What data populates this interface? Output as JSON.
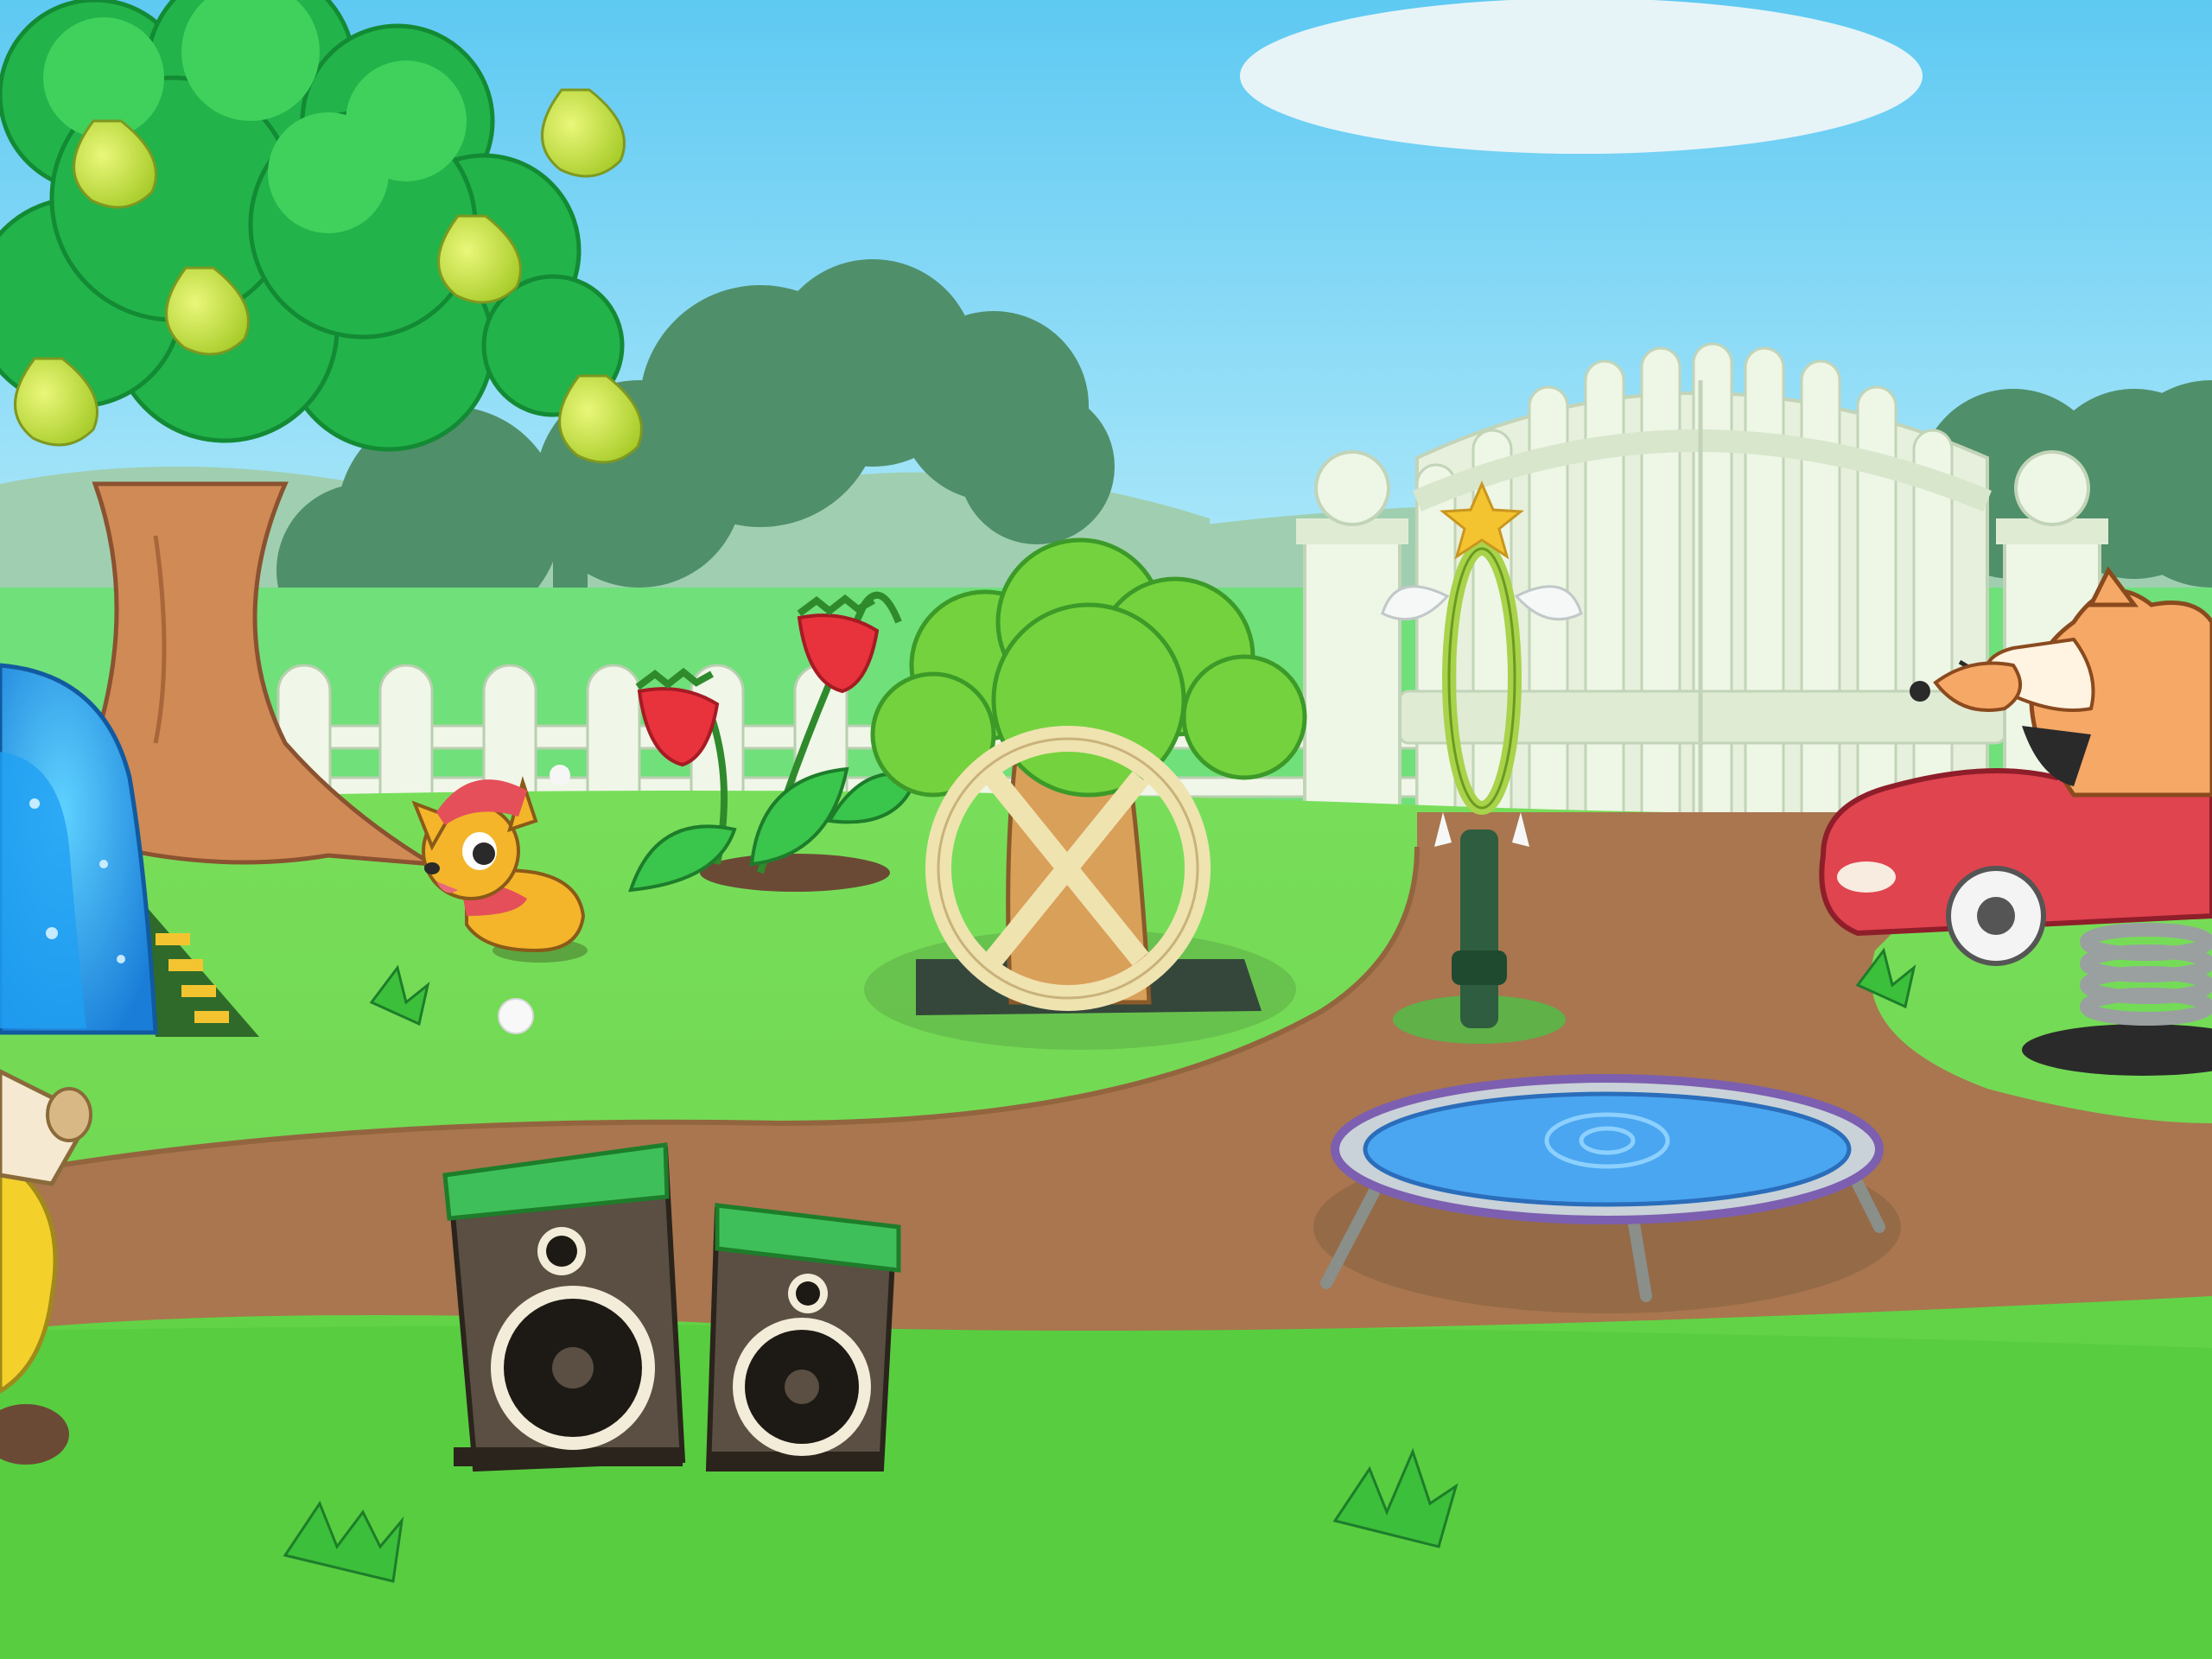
{
  "scene": {
    "colors": {
      "sky_top": "#5ec9f2",
      "sky_bottom": "#a6e6fb",
      "grass_back": "#7fe06a",
      "grass_front": "#8fe04f",
      "grass_dark": "#55c94a",
      "path": "#a9764f",
      "path_edge": "#8f5f3d",
      "fence": "#f0f6e8",
      "gate": "#e6f0dc",
      "tree_leaf": "#22b34a",
      "tree_leaf_light": "#3fd15c",
      "trunk": "#d08a55",
      "pear": "#c9e34a",
      "strawberry": "#e8323c",
      "car": "#e0444f",
      "trampoline": "#4aa6f0",
      "speaker": "#5a4f42",
      "speaker_top": "#3fbf5a"
    },
    "icons": {
      "pear_tree": "pear-tree-icon",
      "strawberry_plant": "strawberry-plant-icon",
      "hamster_wheel": "hamster-wheel-icon",
      "jump_hoop": "jump-hoop-icon",
      "trampoline": "trampoline-icon",
      "spring_car": "spring-car-ride-icon",
      "speakers": "speaker-icon",
      "slide": "slide-icon",
      "gate": "garden-gate-icon",
      "pet_dog": "dog-pet-icon",
      "shiba": "shiba-dog-icon"
    }
  }
}
